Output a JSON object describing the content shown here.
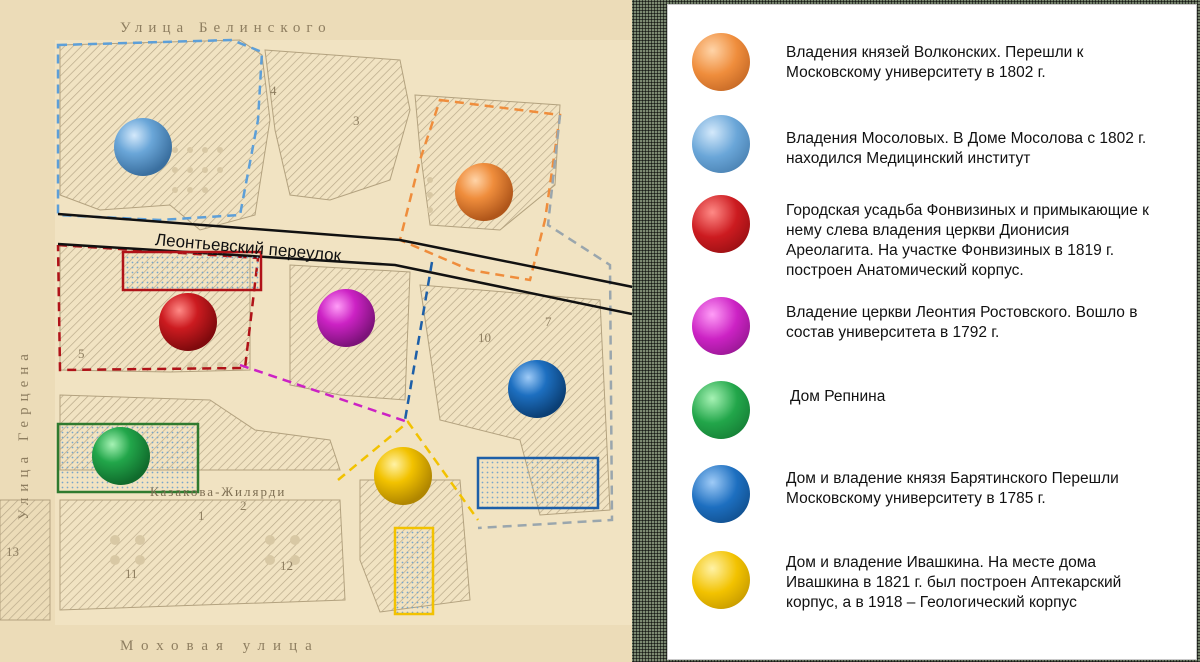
{
  "map": {
    "street_top": "Улица Белинского",
    "street_left": "Улица Герцена",
    "street_bottom": "Моховая улица",
    "lane_label": "Леонтьевский переулок",
    "building_label": "Казакова-Жилярди",
    "plot_numbers": [
      "3",
      "4",
      "5",
      "1",
      "2",
      "10",
      "7",
      "11",
      "12",
      "13"
    ]
  },
  "colors": {
    "orange": "#e8873a",
    "light_blue": "#6aa6d8",
    "red": "#c8161d",
    "magenta": "#cc22c4",
    "green": "#22a64a",
    "blue": "#1d6fc0",
    "yellow": "#f2c200"
  },
  "legend": [
    {
      "color": "orange",
      "text": "Владения князей Волконских. Перешли к Московскому университету в 1802 г."
    },
    {
      "color": "light_blue",
      "text": "Владения Мосоловых. В Доме Мосолова с 1802 г. находился Медицинский институт"
    },
    {
      "color": "red",
      "text": "Городская усадьба Фонвизиных и примыкающие к нему слева владения церкви Дионисия Ареолагита. На участке Фонвизиных в 1819 г. построен Анатомический корпус."
    },
    {
      "color": "magenta",
      "text": "Владение церкви Леонтия Ростовского. Вошло в состав университета в 1792 г."
    },
    {
      "color": "green",
      "text": "Дом Репнина"
    },
    {
      "color": "blue",
      "text": "Дом и владение князя Барятинского Перешли Московскому университету в 1785 г."
    },
    {
      "color": "yellow",
      "text": "Дом и владение Ивашкина. На месте дома Ивашкина в 1821 г. был построен Аптекарский корпус, а в 1918 – Геологический  корпус"
    }
  ]
}
